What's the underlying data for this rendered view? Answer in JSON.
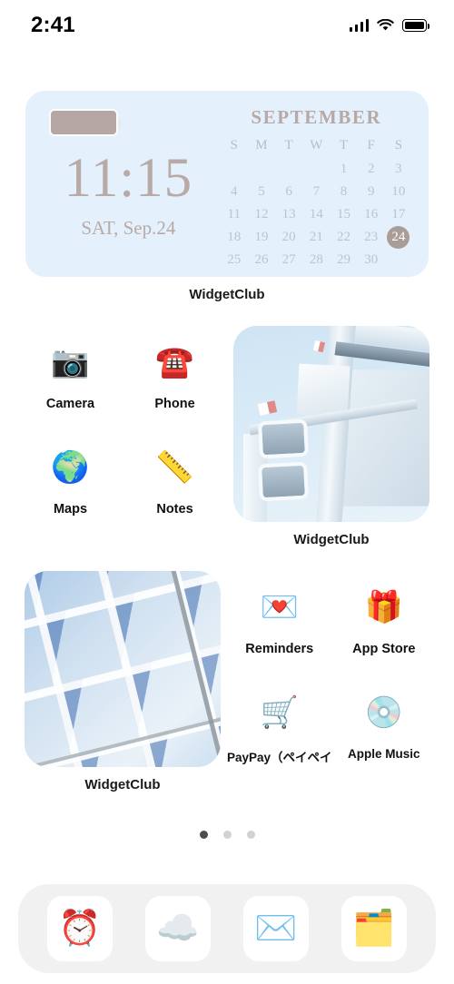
{
  "status_bar": {
    "time": "2:41",
    "cellular_icon": "cellular-signal-icon",
    "wifi_icon": "wifi-icon",
    "battery_icon": "battery-icon"
  },
  "top_widget": {
    "label": "WidgetClub",
    "battery_icon": "battery-widget-icon",
    "time": "11:15",
    "date": "SAT, Sep.24",
    "calendar": {
      "month": "SEPTEMBER",
      "weekdays": [
        "S",
        "M",
        "T",
        "W",
        "T",
        "F",
        "S"
      ],
      "leading_blanks": 4,
      "days": [
        1,
        2,
        3,
        4,
        5,
        6,
        7,
        8,
        9,
        10,
        11,
        12,
        13,
        14,
        15,
        16,
        17,
        18,
        19,
        20,
        21,
        22,
        23,
        24,
        25,
        26,
        27,
        28,
        29,
        30
      ],
      "today": 24,
      "today_highlight_color": "#aa9d98",
      "text_color": "#b9c5d2",
      "background_color": "#e4f0fb"
    }
  },
  "apps_top": [
    {
      "name": "Camera",
      "icon": "camera-icon",
      "glyph": "📷"
    },
    {
      "name": "Phone",
      "icon": "telephone-icon",
      "glyph": "☎️"
    },
    {
      "name": "Maps",
      "icon": "globe-stand-icon",
      "glyph": "🌍"
    },
    {
      "name": "Notes",
      "icon": "tape-measure-icon",
      "glyph": "📏"
    }
  ],
  "apps_bottom": [
    {
      "name": "Reminders",
      "icon": "love-letter-heart-icon",
      "glyph": "💌"
    },
    {
      "name": "App Store",
      "icon": "gift-box-icon",
      "glyph": "🎁"
    },
    {
      "name": "PayPay（ペイペイ",
      "icon": "shopping-cart-icon",
      "glyph": "🛒"
    },
    {
      "name": "Apple Music",
      "icon": "optical-disc-icon",
      "glyph": "💿"
    }
  ],
  "photo_widget_top": {
    "label": "WidgetClub",
    "description": "traffic-light-street-pole-photo"
  },
  "photo_widget_bottom": {
    "label": "WidgetClub",
    "description": "glass-building-windows-photo"
  },
  "page_dots": {
    "count": 3,
    "active_index": 0
  },
  "dock": [
    {
      "name": "Clock",
      "icon": "alarm-clock-icon",
      "glyph": "⏰"
    },
    {
      "name": "Weather",
      "icon": "cloud-icon",
      "glyph": "☁️"
    },
    {
      "name": "Mail",
      "icon": "envelope-icon",
      "glyph": "✉️"
    },
    {
      "name": "Files",
      "icon": "file-folders-icon",
      "glyph": "🗂️"
    }
  ]
}
